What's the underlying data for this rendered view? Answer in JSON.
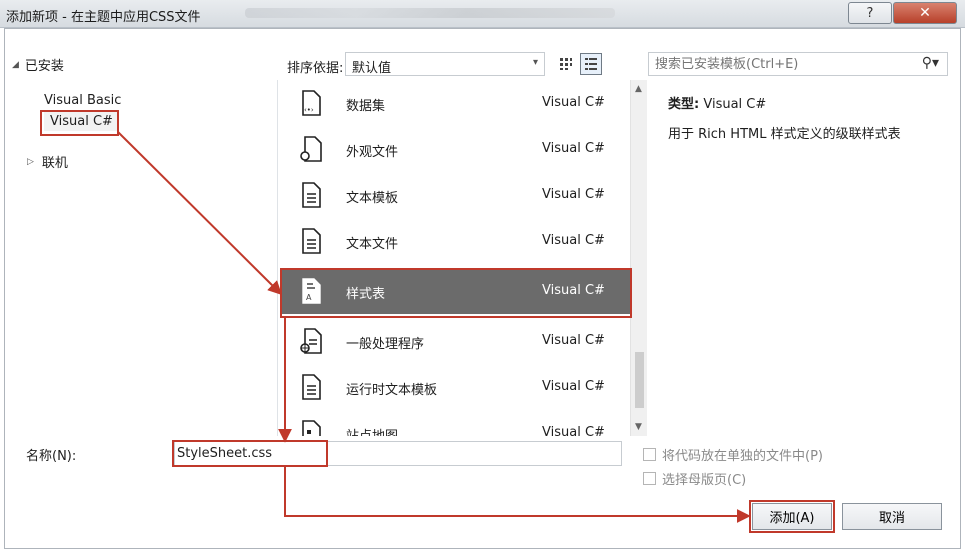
{
  "window": {
    "title": "添加新项 - 在主题中应用CSS文件",
    "help_label": "?",
    "close_label": "✕"
  },
  "left": {
    "header": "已安装",
    "items": [
      {
        "label": "Visual Basic"
      },
      {
        "label": "Visual C#"
      }
    ],
    "online": "联机"
  },
  "toolbar": {
    "sort_label": "排序依据:",
    "sort_value": "默认值",
    "search_placeholder": "搜索已安装模板(Ctrl+E)"
  },
  "templates": [
    {
      "name": "数据集",
      "lang": "Visual C#",
      "icon": "dataset-icon"
    },
    {
      "name": "外观文件",
      "lang": "Visual C#",
      "icon": "skin-file-icon"
    },
    {
      "name": "文本模板",
      "lang": "Visual C#",
      "icon": "text-template-icon"
    },
    {
      "name": "文本文件",
      "lang": "Visual C#",
      "icon": "text-file-icon"
    },
    {
      "name": "样式表",
      "lang": "Visual C#",
      "icon": "stylesheet-icon",
      "selected": true
    },
    {
      "name": "一般处理程序",
      "lang": "Visual C#",
      "icon": "generic-handler-icon"
    },
    {
      "name": "运行时文本模板",
      "lang": "Visual C#",
      "icon": "runtime-template-icon"
    },
    {
      "name": "站点地图",
      "lang": "Visual C#",
      "icon": "sitemap-icon"
    }
  ],
  "details": {
    "type_label": "类型:",
    "type_value": "Visual C#",
    "description": "用于 Rich HTML 样式定义的级联样式表"
  },
  "bottom": {
    "name_label": "名称(N):",
    "name_value": "StyleSheet.css",
    "chk1": "将代码放在单独的文件中(P)",
    "chk2": "选择母版页(C)",
    "add_label": "添加(A)",
    "cancel_label": "取消"
  },
  "colors": {
    "highlight": "#c0392b",
    "selected_row": "#6b6b6b"
  }
}
